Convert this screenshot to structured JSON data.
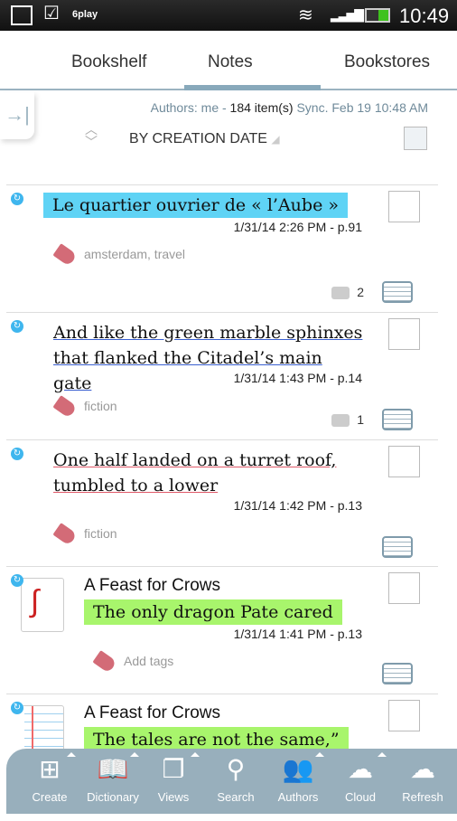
{
  "status": {
    "app": "6play",
    "time": "10:49"
  },
  "tabs": [
    {
      "label": "Bookshelf"
    },
    {
      "label": "Notes",
      "active": true
    },
    {
      "label": "Bookstores"
    }
  ],
  "info": {
    "authors": "Authors: me - ",
    "count": "184 item(s)",
    "sync": " Sync. Feb 19 10:48 AM"
  },
  "sort": {
    "label": "BY CREATION DATE"
  },
  "notes": [
    {
      "text": "Le quartier ouvrier  de «  l’Aube  »",
      "style": "highlight",
      "color": "#5fd3f5",
      "date": "1/31/14 2:26 PM  -  p.91",
      "tags": "amsterdam, travel",
      "comments": "2"
    },
    {
      "text": "And like the green marble sphinxes that flanked the Citadel’s main gate",
      "style": "underline",
      "color": "#3a5fd0",
      "date": "1/31/14 1:43 PM  -  p.14",
      "tags": "fiction",
      "comments": "1"
    },
    {
      "text": "One half landed on a turret roof, tumbled to a lower",
      "style": "underline",
      "color": "#e05a6a",
      "date": "1/31/14 1:42 PM  -  p.13",
      "tags": "fiction"
    },
    {
      "book": "A Feast for Crows",
      "text": "The only dragon Pate cared",
      "style": "highlight",
      "color": "#a8f56c",
      "date": "1/31/14 1:41 PM  -  p.13",
      "tags": "Add tags"
    },
    {
      "book": "A Feast for Crows",
      "text": "The tales are not the same,”",
      "style": "highlight",
      "color": "#a8f56c"
    }
  ],
  "toolbar": [
    {
      "label": "Create",
      "icon": "create-icon",
      "glyph": "⊞"
    },
    {
      "label": "Dictionary",
      "icon": "dictionary-icon",
      "glyph": "📖"
    },
    {
      "label": "Views",
      "icon": "views-icon",
      "glyph": "❐"
    },
    {
      "label": "Search",
      "icon": "search-icon",
      "glyph": "⚲"
    },
    {
      "label": "Authors",
      "icon": "authors-icon",
      "glyph": "👥"
    },
    {
      "label": "Cloud",
      "icon": "cloud-icon",
      "glyph": "☁"
    },
    {
      "label": "Refresh",
      "icon": "refresh-icon",
      "glyph": "☁"
    }
  ]
}
